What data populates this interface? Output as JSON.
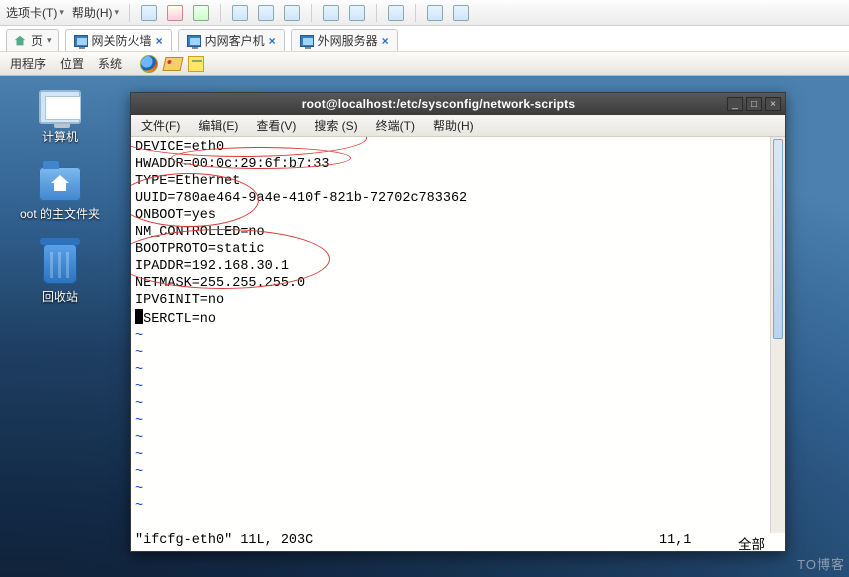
{
  "host_toolbar": {
    "tab_label": "选项卡(T)",
    "help_label": "帮助(H)"
  },
  "vm_tabs": [
    {
      "label": "页",
      "kind": "home"
    },
    {
      "label": "网关防火墙",
      "active": true
    },
    {
      "label": "内网客户机",
      "active": false
    },
    {
      "label": "外网服务器",
      "active": false
    }
  ],
  "gnome_panel": {
    "apps": "用程序",
    "places": "位置",
    "system": "系统"
  },
  "desktop_icons": {
    "computer": "计算机",
    "home": "oot 的主文件夹",
    "trash": "回收站"
  },
  "terminal": {
    "title": "root@localhost:/etc/sysconfig/network-scripts",
    "menu": {
      "file": "文件(F)",
      "edit": "编辑(E)",
      "view": "查看(V)",
      "search": "搜索 (S)",
      "terminal": "终端(T)",
      "help": "帮助(H)"
    },
    "lines": [
      "DEVICE=eth0",
      "HWADDR=00:0c:29:6f:b7:33",
      "TYPE=Ethernet",
      "UUID=780ae464-9a4e-410f-821b-72702c783362",
      "ONBOOT=yes",
      "NM_CONTROLLED=no",
      "BOOTPROTO=static",
      "IPADDR=192.168.30.1",
      "NETMASK=255.255.255.0",
      "IPV6INIT=no",
      "USERCTL=no"
    ],
    "status_left": "\"ifcfg-eth0\" 11L, 203C",
    "status_mid": "11,1",
    "status_right": "全部"
  },
  "watermark": "TO博客"
}
